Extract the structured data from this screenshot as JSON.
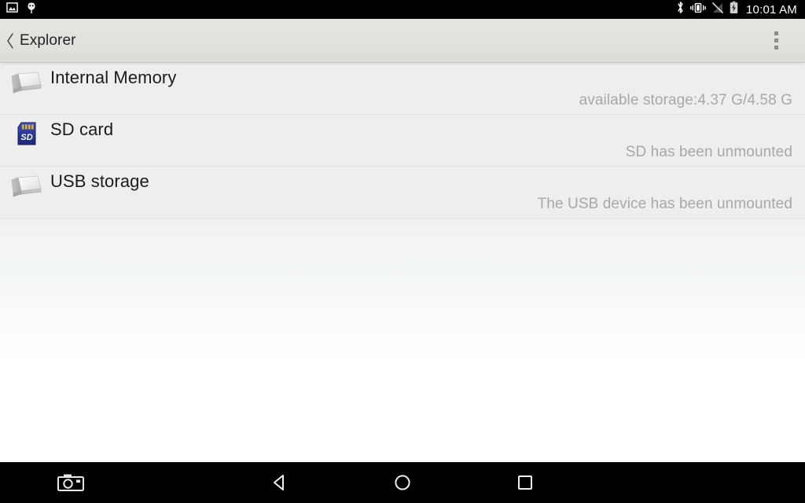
{
  "status_bar": {
    "left_icons": [
      {
        "name": "screenshot-notification-icon",
        "label": "screenshot"
      },
      {
        "name": "android-debug-icon",
        "label": "debug"
      }
    ],
    "right_icons": [
      {
        "name": "bluetooth-icon",
        "label": "bluetooth"
      },
      {
        "name": "vibrate-icon",
        "label": "vibrate"
      },
      {
        "name": "signal-off-icon",
        "label": "no-signal"
      },
      {
        "name": "battery-charging-icon",
        "label": "charging"
      }
    ],
    "clock": "10:01 AM"
  },
  "action_bar": {
    "back_label": "‹",
    "title": "Explorer",
    "overflow_label": "More options"
  },
  "storage_list": [
    {
      "icon": "drive-icon",
      "title": "Internal Memory",
      "subtitle": "available storage:4.37 G/4.58 G"
    },
    {
      "icon": "sd-card-icon",
      "title": "SD card",
      "subtitle": "SD has been unmounted"
    },
    {
      "icon": "drive-icon",
      "title": "USB storage",
      "subtitle": "The USB device has been unmounted"
    }
  ],
  "nav_bar": {
    "buttons": [
      {
        "name": "screenshot-button",
        "label": "Screenshot"
      },
      {
        "name": "back-button",
        "label": "Back"
      },
      {
        "name": "home-button",
        "label": "Home"
      },
      {
        "name": "recents-button",
        "label": "Recents"
      }
    ]
  },
  "colors": {
    "status_bar_bg": "#000000",
    "action_bar_bg": "#e2e2de",
    "list_bg": "#eeeeee",
    "title_text": "#1b1b1b",
    "subtitle_text": "#a8a8a8",
    "sd_card_blue": "#2b3a97",
    "nav_bar_bg": "#000000"
  }
}
